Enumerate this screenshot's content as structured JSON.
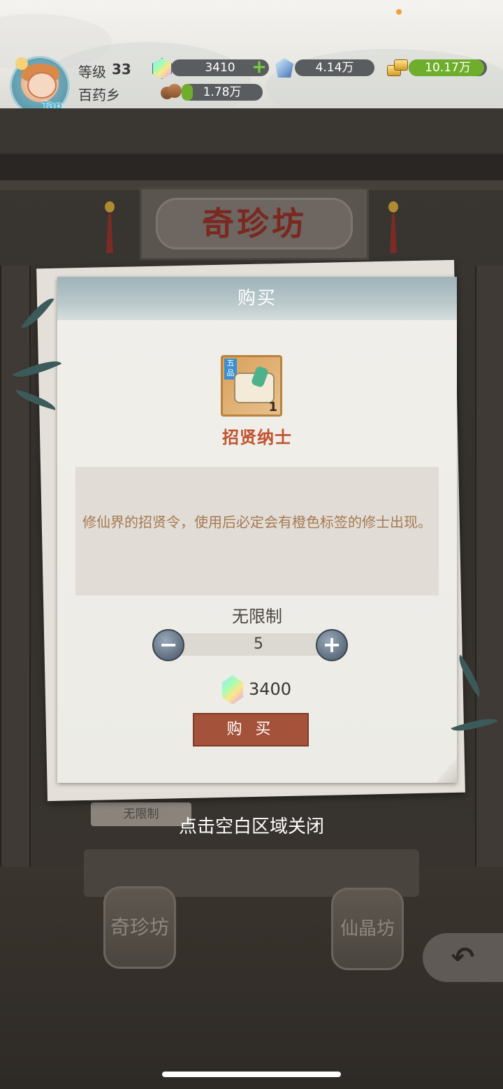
{
  "header": {
    "level_label": "等级",
    "level_value": "33",
    "location": "百药乡",
    "avatar_badge": "Tap",
    "resources": {
      "gem": "3410",
      "crystal": "4.14万",
      "gold": "10.17万",
      "wood": "1.78万"
    },
    "plus_symbol": "+"
  },
  "shop": {
    "sign": "奇珍坊",
    "jar_left": "奇珍坊",
    "jar_right": "仙晶坊",
    "tag_text": "无限制",
    "back_symbol": "↶"
  },
  "dialog": {
    "title": "购买",
    "item": {
      "badge": "五品",
      "count": "1",
      "name": "招贤纳士"
    },
    "description": "修仙界的招贤令，使用后必定会有橙色标签的修士出现。",
    "limit": "无限制",
    "quantity": "5",
    "minus": "−",
    "plus": "+",
    "price": "3400",
    "buy_label": "购 买"
  },
  "close_hint": "点击空白区域关闭",
  "colors": {
    "accent_red": "#a4523a",
    "item_name": "#c0532e",
    "progress_green": "#6fae2c"
  },
  "icons": [
    "gem-icon",
    "crystal-icon",
    "gold-icon",
    "wood-icon",
    "minus-icon",
    "plus-icon",
    "back-arrow-icon"
  ]
}
